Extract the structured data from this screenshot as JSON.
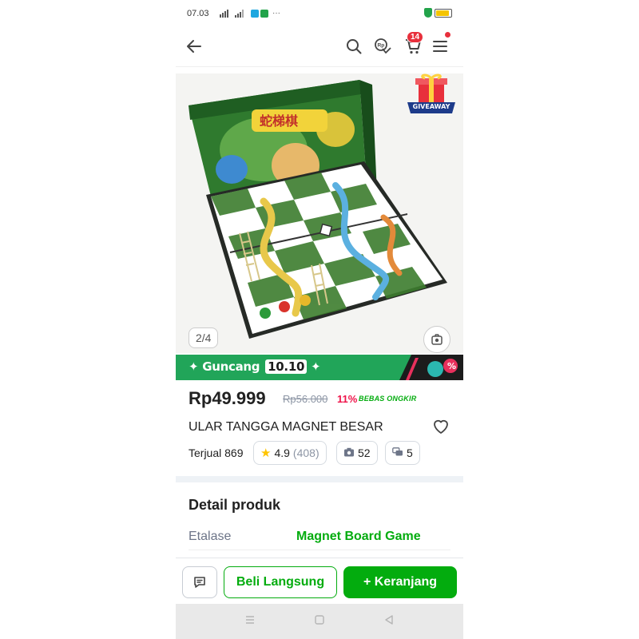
{
  "status_bar": {
    "time": "07.03",
    "more": "···",
    "battery_level": 0.9,
    "colors": {
      "app1": "#1ea7e0",
      "app2": "#22a34a",
      "shield": "#22a34a",
      "battery": "#f5c400"
    }
  },
  "header": {
    "back_icon": "arrow-left-icon",
    "search_icon": "search-icon",
    "chat_icon": "rp-chat-icon",
    "cart_icon": "cart-icon",
    "cart_badge": "14",
    "menu_icon": "hamburger-menu-icon"
  },
  "gallery": {
    "counter": "2/4",
    "giveaway_label": "GIVEAWAY",
    "camera_icon": "camera-icon"
  },
  "banner": {
    "prefix": "Guncang",
    "number": "10.10"
  },
  "product": {
    "price": "Rp49.999",
    "old_price": "Rp56.000",
    "discount": "11%",
    "shipping": "BEBAS ONGKIR",
    "title": "ULAR TANGGA MAGNET BESAR",
    "sold": "Terjual 869",
    "rating": "4.9",
    "rating_count": "(408)",
    "photos": "52",
    "discussions": "5"
  },
  "details": {
    "heading": "Detail produk",
    "rows": [
      {
        "label": "Etalase",
        "value": "Magnet Board Game"
      }
    ]
  },
  "actions": {
    "buy_now": "Beli Langsung",
    "add_to_cart": "+ Keranjang"
  },
  "theme": {
    "accent": "#03ac0e",
    "price_red": "#ef144a",
    "badge_red": "#e8303c"
  }
}
